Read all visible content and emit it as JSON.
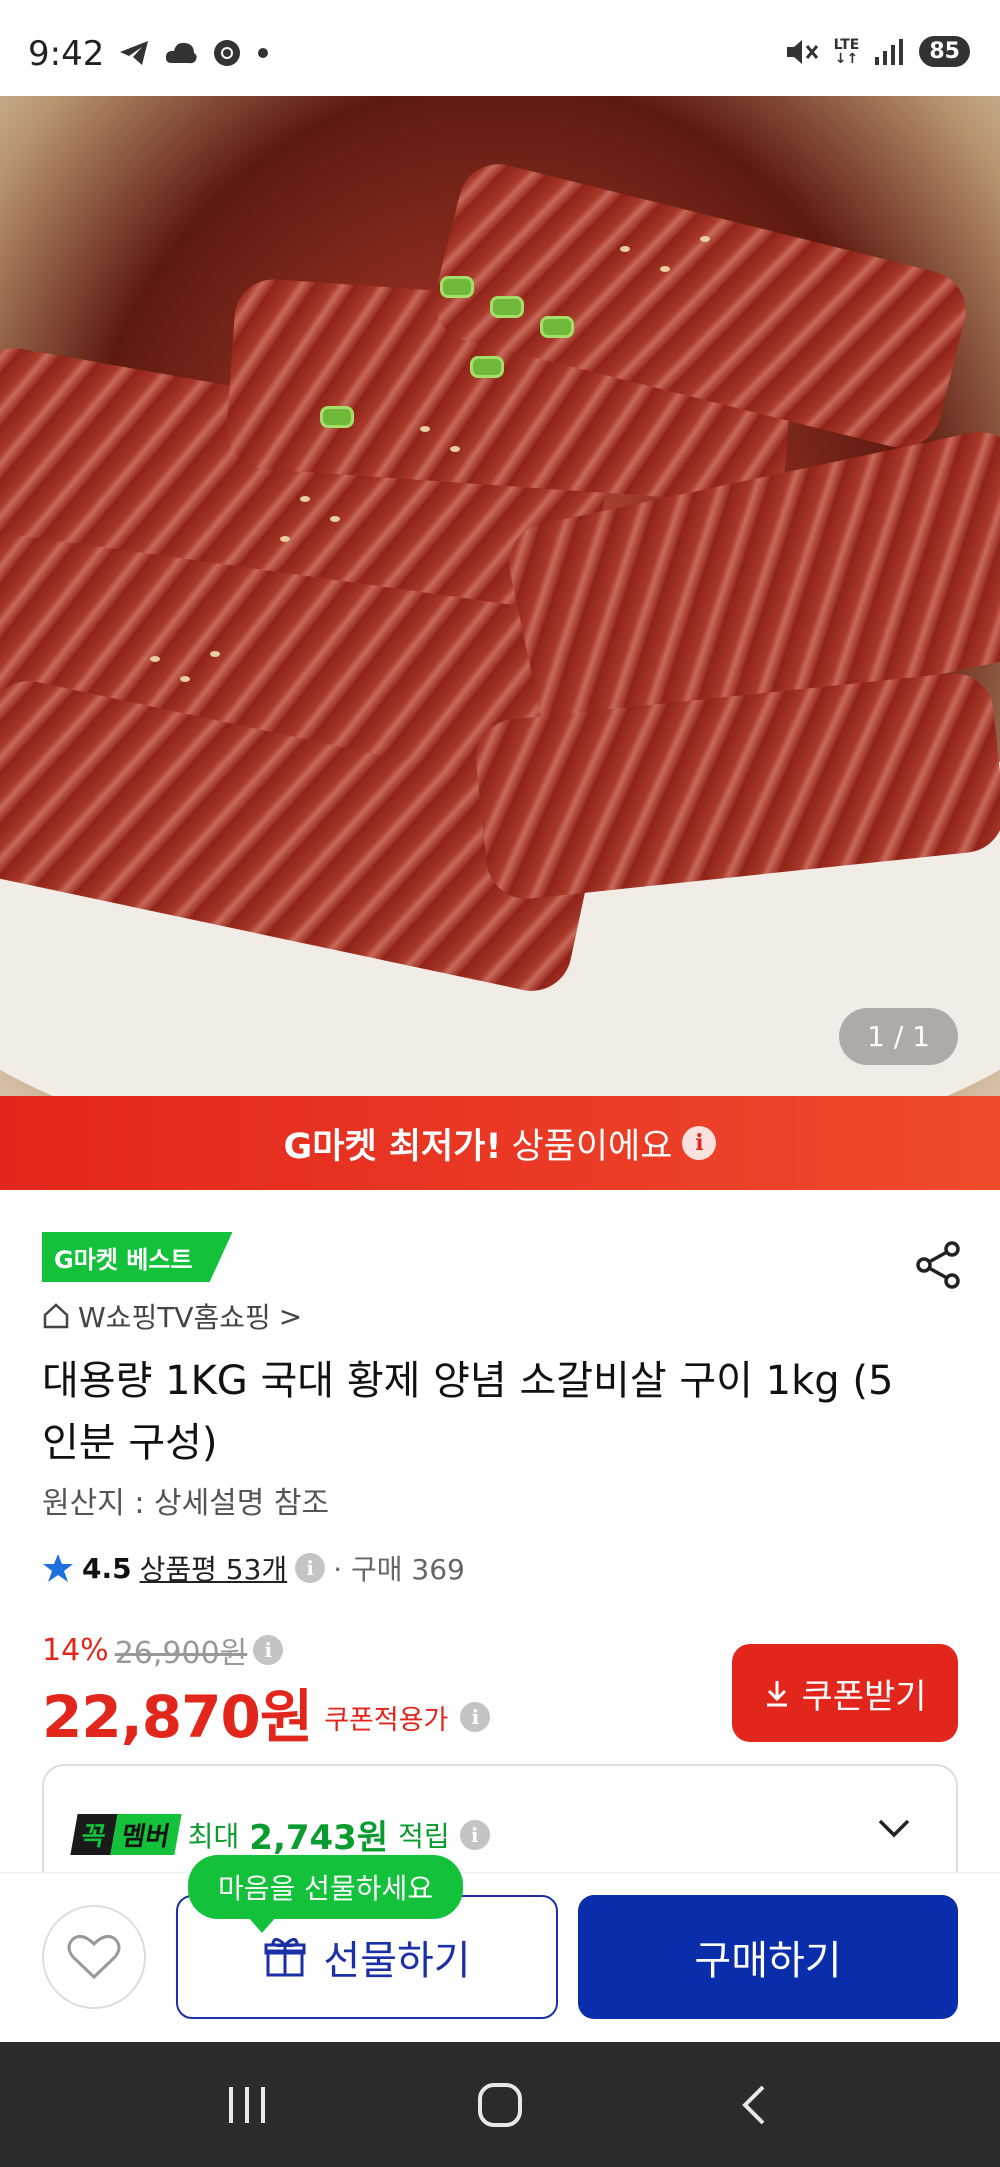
{
  "status_bar": {
    "time": "9:42",
    "battery": "85",
    "network": "LTE",
    "left_icons": [
      "telegram-icon",
      "cloud-icon",
      "chrome-icon",
      "dot-icon"
    ],
    "right_icons": [
      "mute-icon",
      "lte-icon",
      "signal-icon",
      "battery-icon"
    ]
  },
  "gallery": {
    "counter": "1 / 1"
  },
  "banner": {
    "strong": "G마켓 최저가!",
    "rest": "상품이에요",
    "info": "i"
  },
  "product": {
    "badge": "G마켓 베스트",
    "seller": "W쇼핑TV홈쇼핑",
    "seller_chevron": ">",
    "title": "대용량 1KG 국대 황제 양념 소갈비살 구이 1kg (5인분 구성)",
    "origin": "원산지 : 상세설명 참조",
    "rating_score": "4.5",
    "reviews": "상품평 53개",
    "purchases": "· 구매 369",
    "discount_pct": "14%",
    "original_price": "26,900원",
    "price": "22,870원",
    "coupon_price_label": "쿠폰적용가",
    "coupon_button": "쿠폰받기"
  },
  "membership": {
    "logo_k": "꼭",
    "logo_m": "멤버",
    "max_label": "최대",
    "amount": "2,743원",
    "suffix": "적립"
  },
  "actions": {
    "gift_tooltip": "마음을 선물하세요",
    "gift_button": "선물하기",
    "buy_button": "구매하기"
  },
  "colors": {
    "brand_red": "#e3261b",
    "brand_green": "#13c13b",
    "buy_blue": "#0a2eab"
  }
}
